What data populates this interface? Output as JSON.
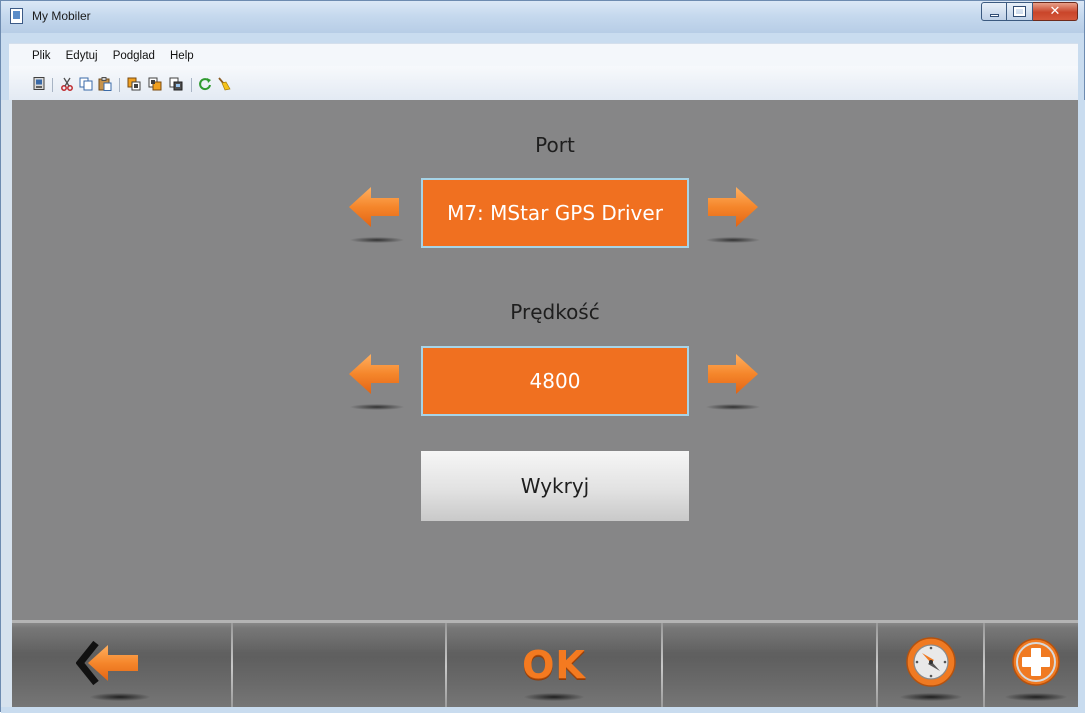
{
  "window": {
    "title": "My Mobiler"
  },
  "menu": {
    "items": [
      {
        "label": "Plik"
      },
      {
        "label": "Edytuj"
      },
      {
        "label": "Podglad"
      },
      {
        "label": "Help"
      }
    ]
  },
  "toolbar": {
    "icons": [
      "device-icon",
      "cut-icon",
      "copy-icon",
      "paste-icon",
      "copy-to-device-icon",
      "copy-from-device-icon",
      "screenshot-icon",
      "refresh-icon",
      "clean-icon"
    ]
  },
  "screen": {
    "port": {
      "label": "Port",
      "value": "M7: MStar GPS Driver"
    },
    "speed": {
      "label": "Prędkość",
      "value": "4800"
    },
    "detect_label": "Wykryj",
    "bottom_bar": {
      "ok_label": "OK"
    }
  },
  "colors": {
    "accent_orange": "#f07020",
    "screen_bg": "#868687",
    "value_border": "#a6d4e8"
  }
}
